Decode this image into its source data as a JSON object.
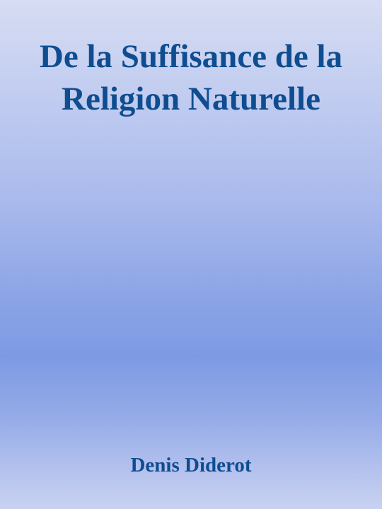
{
  "cover": {
    "title": "De la Suffisance de la Religion Naturelle",
    "author": "Denis Diderot"
  },
  "colors": {
    "text": "#0f4d91",
    "background_top": "#d6dcf3",
    "background_middle": "#7d9ae3",
    "background_bottom": "#c8d2f0"
  }
}
